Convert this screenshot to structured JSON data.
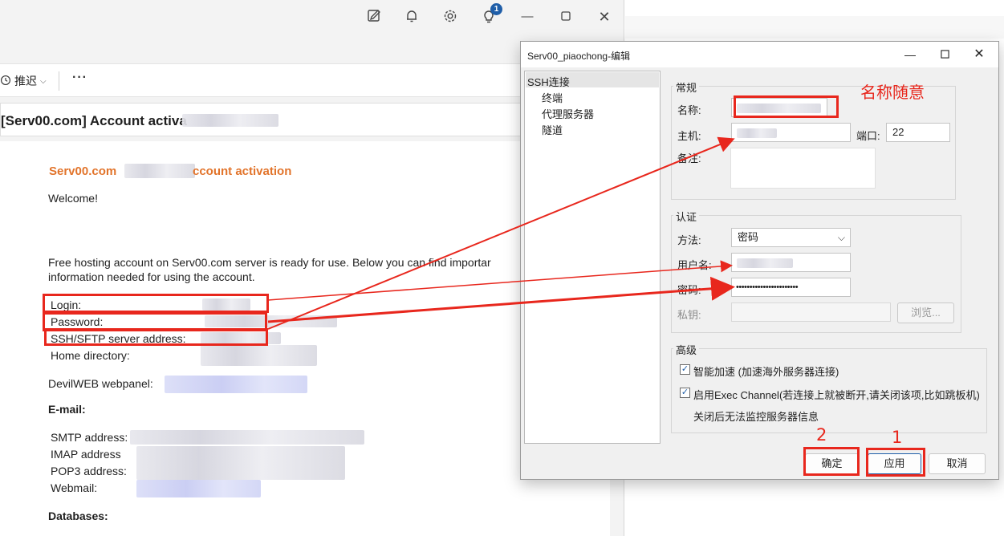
{
  "mail": {
    "toolbar": {
      "snooze_label": "推迟",
      "more_label": "···"
    },
    "topbar_badge": "1",
    "subject": "[Serv00.com] Account activa",
    "body": {
      "heading_left": "Serv00.com",
      "heading_right": "ccount activation",
      "welcome": "Welcome!",
      "intro_line1": "Free hosting account on Serv00.com server is ready for use. Below you can find importar",
      "intro_line2": "information needed for using the account.",
      "login_label": "Login:",
      "password_label": "Password:",
      "ssh_label": "SSH/SFTP server address:",
      "home_label": "Home directory:",
      "devilweb_label": "DevilWEB webpanel:",
      "email_heading": "E-mail:",
      "smtp_label": "SMTP address:",
      "imap_label": "IMAP address",
      "pop3_label": "POP3 address:",
      "webmail_label": "Webmail:",
      "databases_heading": "Databases:"
    }
  },
  "dialog": {
    "title": "Serv00_piaochong-编辑",
    "tree": {
      "root": "SSH连接",
      "children": [
        "终端",
        "代理服务器",
        "隧道"
      ]
    },
    "general": {
      "group_title": "常规",
      "name_label": "名称:",
      "host_label": "主机:",
      "port_label": "端口:",
      "port_value": "22",
      "note_label": "备注:"
    },
    "auth": {
      "group_title": "认证",
      "method_label": "方法:",
      "method_value": "密码",
      "user_label": "用户名:",
      "password_label": "密码:",
      "password_value": "•••••••••••••••••••••••",
      "key_label": "私钥:",
      "browse_label": "浏览..."
    },
    "advanced": {
      "group_title": "高级",
      "opt1_label": "智能加速 (加速海外服务器连接)",
      "opt1_checked": true,
      "opt2_label": "启用Exec Channel(若连接上就被断开,请关闭该项,比如跳板机)",
      "opt2_checked": true,
      "opt2_note": "关闭后无法监控服务器信息"
    },
    "buttons": {
      "ok": "确定",
      "apply": "应用",
      "cancel": "取消"
    }
  },
  "annotations": {
    "name_hint": "名称随意",
    "step1": "1",
    "step2": "2",
    "color": "#e8271d"
  }
}
